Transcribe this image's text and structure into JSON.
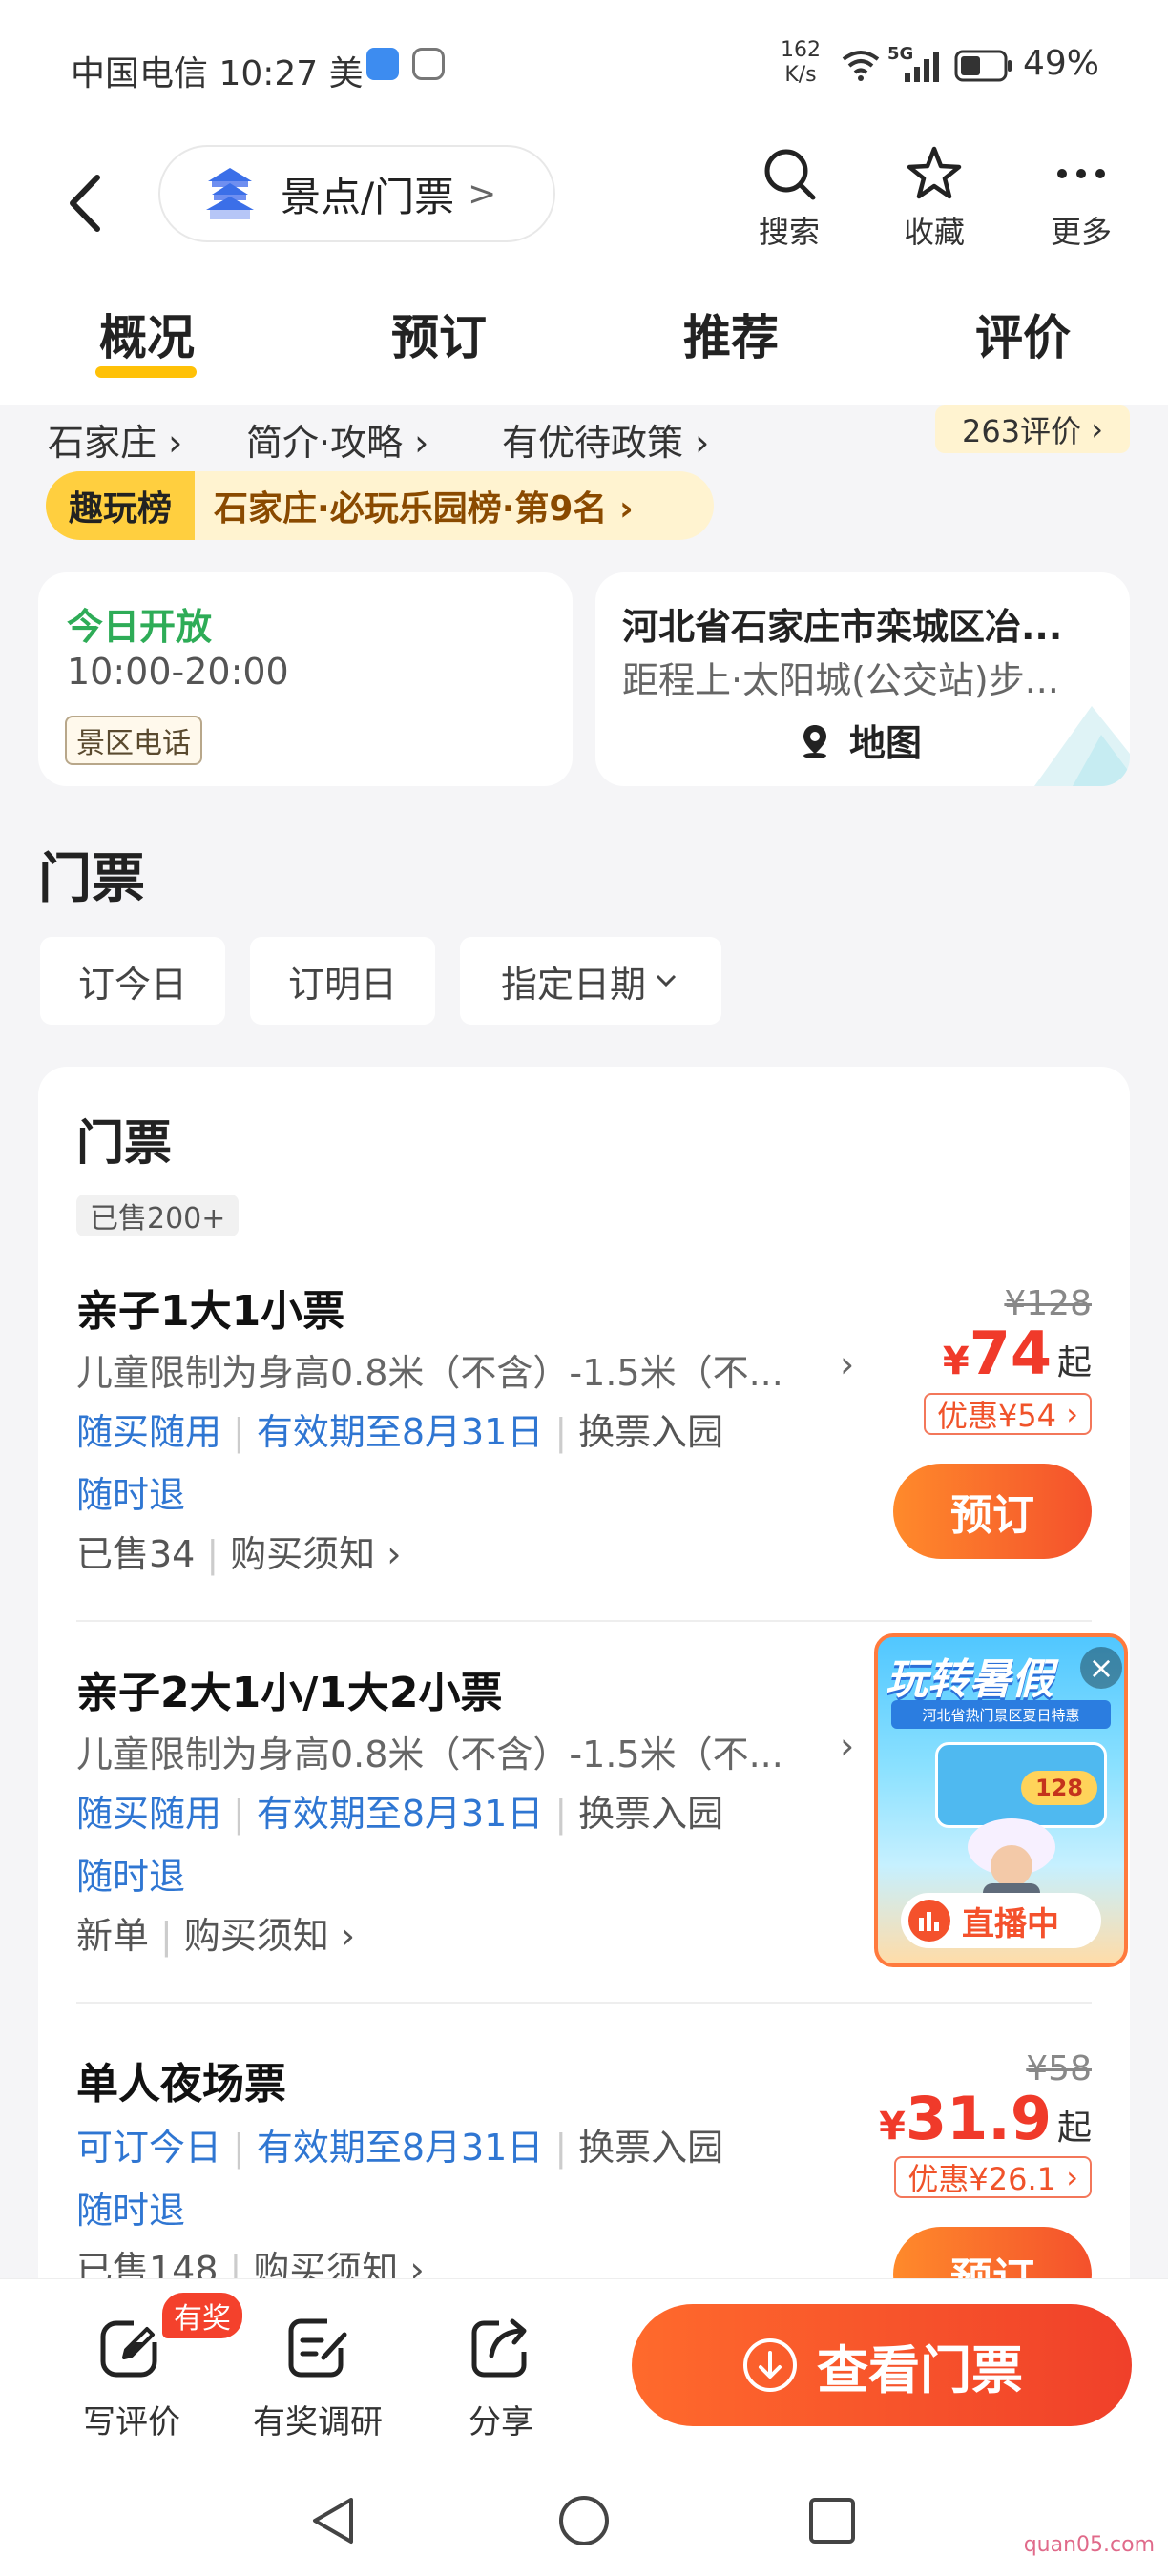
{
  "status_bar": {
    "carrier": "中国电信",
    "time": "10:27",
    "extra": "美",
    "speed_value": "162",
    "speed_unit": "K/s",
    "network": "5G",
    "battery": "49%"
  },
  "header": {
    "back_icon": "chevron-left-icon",
    "breadcrumb_label": "景点/门票",
    "breadcrumb_chevron": ">",
    "actions": [
      {
        "label": "搜索",
        "icon": "search-icon"
      },
      {
        "label": "收藏",
        "icon": "star-icon"
      },
      {
        "label": "更多",
        "icon": "more-icon"
      }
    ]
  },
  "tabs": [
    {
      "label": "概况",
      "active": true
    },
    {
      "label": "预订"
    },
    {
      "label": "推荐"
    },
    {
      "label": "评价"
    }
  ],
  "info_row": {
    "city": "石家庄",
    "intro": "简介·攻略",
    "policy": "有优待政策",
    "reviews": "263评价"
  },
  "ranking": {
    "tag": "趣玩榜",
    "text": "石家庄·必玩乐园榜·第9名"
  },
  "hours_card": {
    "status": "今日开放",
    "hours": "10:00-20:00",
    "phone_label": "景区电话"
  },
  "address_card": {
    "address": "河北省石家庄市栾城区冶...",
    "transit": "距程上·太阳城(公交站)步...",
    "map_label": "地图"
  },
  "tickets_section": {
    "title": "门票",
    "date_buttons": [
      "订今日",
      "订明日",
      "指定日期"
    ],
    "group_title": "门票",
    "group_sold": "已售200+"
  },
  "tickets": [
    {
      "name": "亲子1大1小票",
      "desc": "儿童限制为身高0.8米（不含）-1.5米（不...",
      "tag1": "随买随用",
      "tag2": "有效期至8月31日",
      "tag3": "换票入园",
      "refund": "随时退",
      "sold": "已售34",
      "notice": "购买须知",
      "original_price": "¥128",
      "currency": "¥",
      "price": "74",
      "price_suffix": "起",
      "coupon": "优惠¥54",
      "book_label": "预订"
    },
    {
      "name": "亲子2大1小/1大2小票",
      "desc": "儿童限制为身高0.8米（不含）-1.5米（不...",
      "tag1": "随买随用",
      "tag2": "有效期至8月31日",
      "tag3": "换票入园",
      "refund": "随时退",
      "sold": "新单",
      "notice": "购买须知"
    },
    {
      "name": "单人夜场票",
      "tag1": "可订今日",
      "tag2": "有效期至8月31日",
      "tag3": "换票入园",
      "refund": "随时退",
      "sold": "已售148",
      "notice": "购买须知",
      "original_price": "¥58",
      "currency": "¥",
      "price": "31.9",
      "price_suffix": "起",
      "coupon": "优惠¥26.1",
      "book_label": "预订"
    }
  ],
  "live_promo": {
    "title": "玩转暑假",
    "subtitle": "河北省热门景区夏日特惠",
    "badge_label": "直播中",
    "close_icon": "close-icon",
    "deal_value": "128"
  },
  "bottom_bar": {
    "actions": [
      {
        "label": "写评价",
        "icon": "edit-icon",
        "badge": "有奖"
      },
      {
        "label": "有奖调研",
        "icon": "survey-icon"
      },
      {
        "label": "分享",
        "icon": "share-icon"
      }
    ],
    "cta_label": "查看门票"
  },
  "watermark": "quan05.com",
  "colors": {
    "accent_orange": "#f4512c",
    "price_red": "#f03a2a",
    "link_blue": "#2f76d2",
    "open_green": "#2eac57",
    "tab_underline": "#ffc107"
  }
}
